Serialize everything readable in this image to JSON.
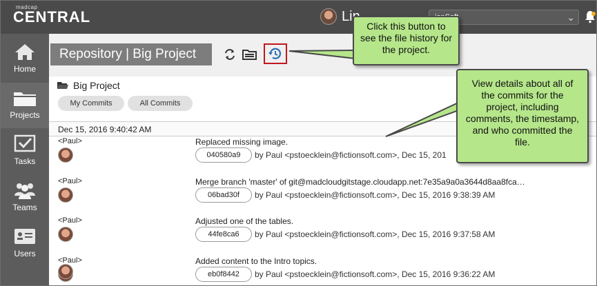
{
  "app": {
    "logo_small": "madcap",
    "logo_big": "CENTRAL",
    "user_name": "Lin",
    "org_select_value": "ionSoft"
  },
  "sidebar": {
    "items": [
      {
        "label": "Home",
        "icon": "home-icon"
      },
      {
        "label": "Projects",
        "icon": "folder-icon"
      },
      {
        "label": "Tasks",
        "icon": "task-checkbox-icon"
      },
      {
        "label": "Teams",
        "icon": "team-people-icon"
      },
      {
        "label": "Users",
        "icon": "user-card-icon"
      }
    ],
    "active": "Projects"
  },
  "header": {
    "title": "Repository | Big Project",
    "tools": [
      "sync-icon",
      "folder-open-icon",
      "history-icon"
    ]
  },
  "project": {
    "name": "Big Project",
    "filters": [
      "My Commits",
      "All Commits"
    ],
    "date_group": "Dec 15, 2016 9:40:42 AM"
  },
  "commits": [
    {
      "author": "<Paul>",
      "message": "Replaced missing image.",
      "hash": "040580a9",
      "by": "by Paul <pstoecklein@fictionsoft.com>, Dec 15, 201"
    },
    {
      "author": "<Paul>",
      "message": "Merge branch 'master' of git@madcloudgitstage.cloudapp.net:7e35a9a0a3644d8aa8fca…",
      "hash": "06bad30f",
      "by": "by Paul <pstoecklein@fictionsoft.com>, Dec 15, 2016 9:38:39 AM"
    },
    {
      "author": "<Paul>",
      "message": "Adjusted one of the tables.",
      "hash": "44fe8ca6",
      "by": "by Paul <pstoecklein@fictionsoft.com>, Dec 15, 2016 9:37:58 AM"
    },
    {
      "author": "<Paul>",
      "message": "Added content to the Intro topics.",
      "hash": "eb0f8442",
      "by": "by Paul <pstoecklein@fictionsoft.com>, Dec 15, 2016 9:36:22 AM"
    },
    {
      "author": "<Paul>",
      "message": "",
      "hash": "",
      "by": ""
    }
  ],
  "callouts": {
    "history_button": "Click this button to see the file history for the project.",
    "details": "View details about all of the commits for the project, including comments, the timestamp, and who committed the file."
  },
  "colors": {
    "topbar": "#4a4a4a",
    "sidebar": "#5c5c5c",
    "callout": "#b5e68a",
    "highlight": "#c0171d"
  }
}
